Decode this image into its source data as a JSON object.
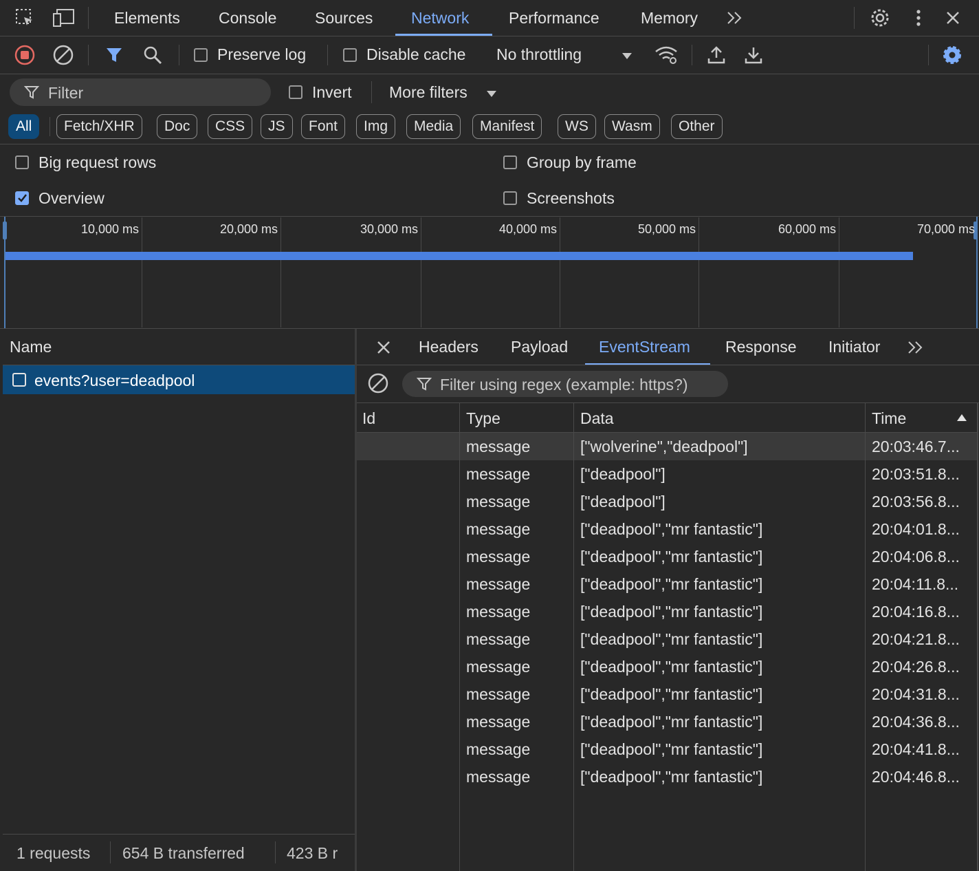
{
  "toolbar": {
    "tabs": [
      "Elements",
      "Console",
      "Sources",
      "Network",
      "Performance",
      "Memory"
    ],
    "active_tab": "Network"
  },
  "network_toolbar": {
    "preserve_log": "Preserve log",
    "disable_cache": "Disable cache",
    "throttling": "No throttling"
  },
  "filter_bar": {
    "filter_placeholder": "Filter",
    "invert": "Invert",
    "more_filters": "More filters"
  },
  "type_filters": [
    "All",
    "Fetch/XHR",
    "Doc",
    "CSS",
    "JS",
    "Font",
    "Img",
    "Media",
    "Manifest",
    "WS",
    "Wasm",
    "Other"
  ],
  "settings": {
    "big_request_rows": "Big request rows",
    "group_by_frame": "Group by frame",
    "overview": "Overview",
    "screenshots": "Screenshots",
    "overview_checked": true
  },
  "overview": {
    "ticks": [
      "10,000 ms",
      "20,000 ms",
      "30,000 ms",
      "40,000 ms",
      "50,000 ms",
      "60,000 ms",
      "70,000 ms"
    ]
  },
  "requests": {
    "column_name": "Name",
    "items": [
      "events?user=deadpool"
    ]
  },
  "detail": {
    "tabs": [
      "Headers",
      "Payload",
      "EventStream",
      "Response",
      "Initiator"
    ],
    "active_tab": "EventStream",
    "filter_placeholder": "Filter using regex (example: https?)",
    "columns": [
      "Id",
      "Type",
      "Data",
      "Time"
    ],
    "rows": [
      {
        "type": "message",
        "data": "[\"wolverine\",\"deadpool\"]",
        "time": "20:03:46.7..."
      },
      {
        "type": "message",
        "data": "[\"deadpool\"]",
        "time": "20:03:51.8..."
      },
      {
        "type": "message",
        "data": "[\"deadpool\"]",
        "time": "20:03:56.8..."
      },
      {
        "type": "message",
        "data": "[\"deadpool\",\"mr fantastic\"]",
        "time": "20:04:01.8..."
      },
      {
        "type": "message",
        "data": "[\"deadpool\",\"mr fantastic\"]",
        "time": "20:04:06.8..."
      },
      {
        "type": "message",
        "data": "[\"deadpool\",\"mr fantastic\"]",
        "time": "20:04:11.8..."
      },
      {
        "type": "message",
        "data": "[\"deadpool\",\"mr fantastic\"]",
        "time": "20:04:16.8..."
      },
      {
        "type": "message",
        "data": "[\"deadpool\",\"mr fantastic\"]",
        "time": "20:04:21.8..."
      },
      {
        "type": "message",
        "data": "[\"deadpool\",\"mr fantastic\"]",
        "time": "20:04:26.8..."
      },
      {
        "type": "message",
        "data": "[\"deadpool\",\"mr fantastic\"]",
        "time": "20:04:31.8..."
      },
      {
        "type": "message",
        "data": "[\"deadpool\",\"mr fantastic\"]",
        "time": "20:04:36.8..."
      },
      {
        "type": "message",
        "data": "[\"deadpool\",\"mr fantastic\"]",
        "time": "20:04:41.8..."
      },
      {
        "type": "message",
        "data": "[\"deadpool\",\"mr fantastic\"]",
        "time": "20:04:46.8..."
      }
    ]
  },
  "status_bar": {
    "requests": "1 requests",
    "transferred": "654 B transferred",
    "resources": "423 B r"
  },
  "colors": {
    "accent": "#7cacf8",
    "record_red": "#e46962",
    "selected_row": "#0e4a7a",
    "background": "#282828"
  }
}
